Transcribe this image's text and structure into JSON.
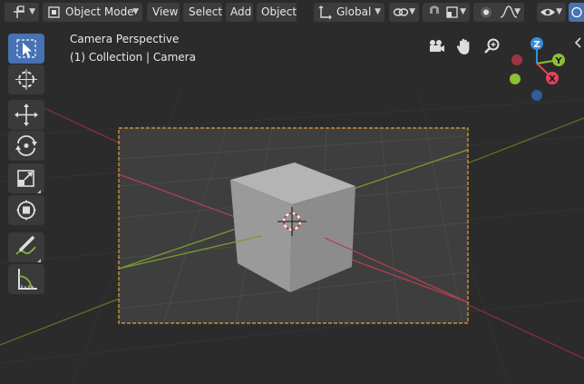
{
  "header": {
    "mode": "Object Mode",
    "menus": [
      "View",
      "Select",
      "Add",
      "Object"
    ],
    "transform_orientation": "Global"
  },
  "overlay": {
    "view_name": "Camera Perspective",
    "collection_info": "(1) Collection | Camera"
  },
  "gizmo": {
    "x_label": "X",
    "y_label": "Y",
    "z_label": "Z",
    "x_color": "#e0445a",
    "y_color": "#8bc034",
    "z_color": "#3b8ddb"
  },
  "toolbar": {
    "tools": [
      "select-box",
      "cursor",
      "move",
      "rotate",
      "scale",
      "transform",
      "annotate",
      "measure"
    ],
    "active": "select-box"
  },
  "colors": {
    "camera_frame": "#e8a03a",
    "background": "#2b2b2b",
    "cube": "#a0a0a0",
    "accent": "#4772b3"
  }
}
